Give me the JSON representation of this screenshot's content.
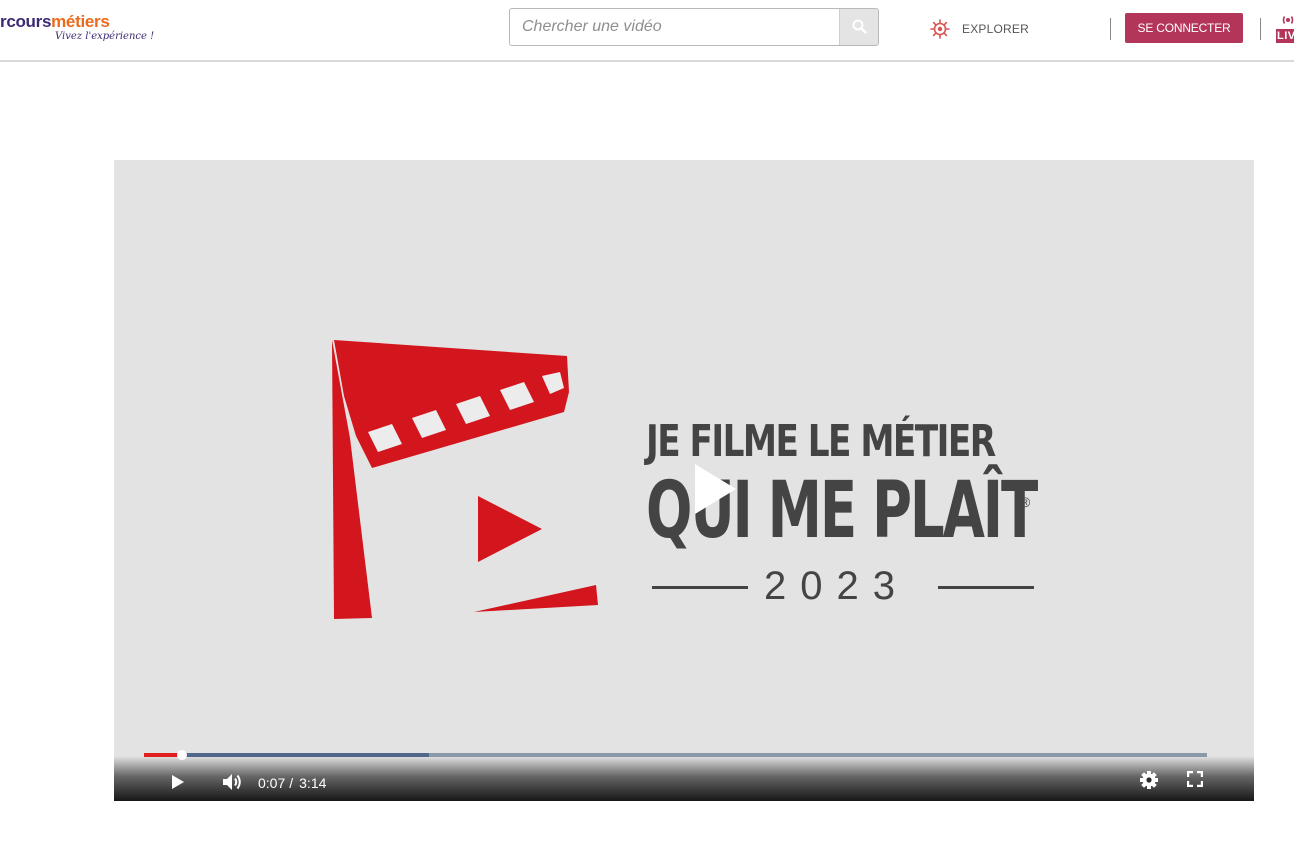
{
  "header": {
    "logo": {
      "part1": "rcours",
      "part2": "métiers",
      "tagline": "Vivez l'expérience !"
    },
    "search": {
      "placeholder": "Chercher une vidéo",
      "value": ""
    },
    "explore_label": "EXPLORER",
    "connect_label": "SE CONNECTER",
    "live_label": "LIVE"
  },
  "video": {
    "title_line1": "JE FILME LE MÉTIER",
    "title_line2": "QUI ME PLAÎT",
    "registered_mark": "®",
    "year": "2023",
    "current_time": "0:07",
    "time_separator": "/",
    "duration": "3:14",
    "progress_played_fraction": 0.036,
    "progress_buffered_fraction": 0.268
  },
  "colors": {
    "brand_purple": "#3d2a74",
    "brand_orange": "#ec6a1c",
    "connect_button": "#b3365a",
    "logo_red": "#d3161d",
    "progress_played": "#e01f1f"
  }
}
